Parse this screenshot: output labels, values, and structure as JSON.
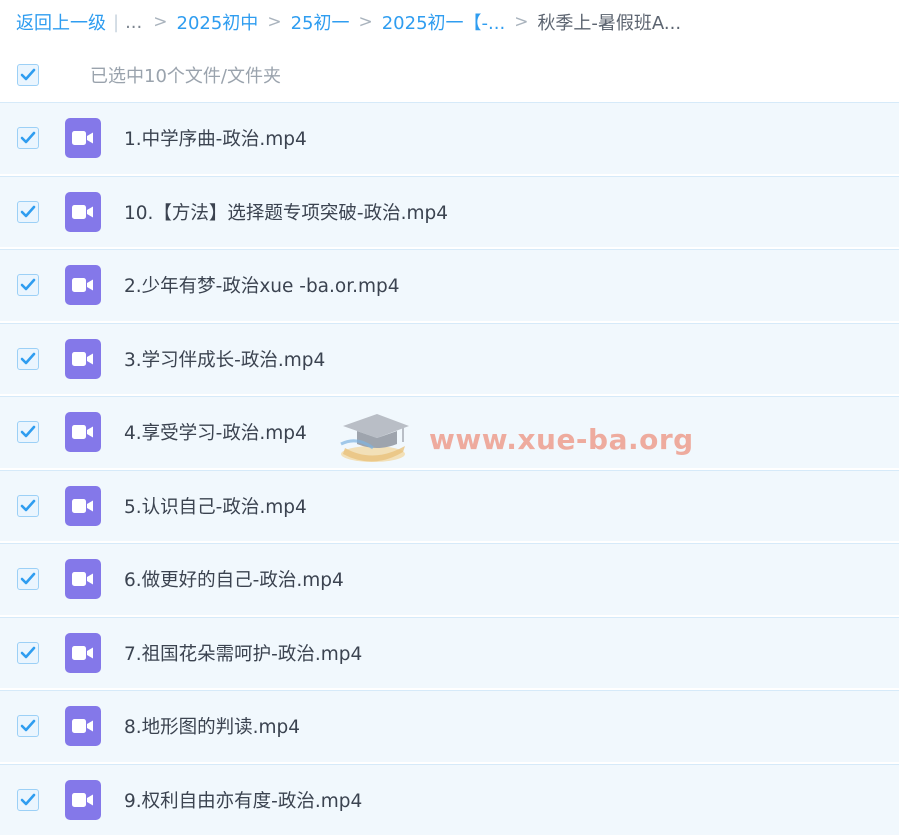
{
  "breadcrumb": {
    "back_label": "返回上一级",
    "separator": "|",
    "ellipsis": "...",
    "arrow": ">",
    "items": [
      "2025初中",
      "25初一",
      "2025初一【-..."
    ],
    "current": "秋季上-暑假班A..."
  },
  "selection": {
    "count_text": "已选中10个文件/文件夹",
    "all_checked": true
  },
  "files": [
    {
      "name": "1.中学序曲-政治.mp4",
      "checked": true,
      "icon": "video-file-icon"
    },
    {
      "name": "10.【方法】选择题专项突破-政治.mp4",
      "checked": true,
      "icon": "video-file-icon"
    },
    {
      "name": "2.少年有梦-政治xue -ba.or.mp4",
      "checked": true,
      "icon": "video-file-icon"
    },
    {
      "name": "3.学习伴成长-政治.mp4",
      "checked": true,
      "icon": "video-file-icon"
    },
    {
      "name": "4.享受学习-政治.mp4",
      "checked": true,
      "icon": "video-file-icon"
    },
    {
      "name": "5.认识自己-政治.mp4",
      "checked": true,
      "icon": "video-file-icon"
    },
    {
      "name": "6.做更好的自己-政治.mp4",
      "checked": true,
      "icon": "video-file-icon"
    },
    {
      "name": "7.祖国花朵需呵护-政治.mp4",
      "checked": true,
      "icon": "video-file-icon"
    },
    {
      "name": "8.地形图的判读.mp4",
      "checked": true,
      "icon": "video-file-icon"
    },
    {
      "name": "9.权利自由亦有度-政治.mp4",
      "checked": true,
      "icon": "video-file-icon"
    }
  ],
  "watermark": {
    "text": "www.xue-ba.org",
    "icon": "graduation-cap-icon"
  },
  "colors": {
    "link": "#2f9df0",
    "row_bg": "#f1f8fd",
    "video_icon": "#8478e9",
    "check": "#2f9df0"
  }
}
